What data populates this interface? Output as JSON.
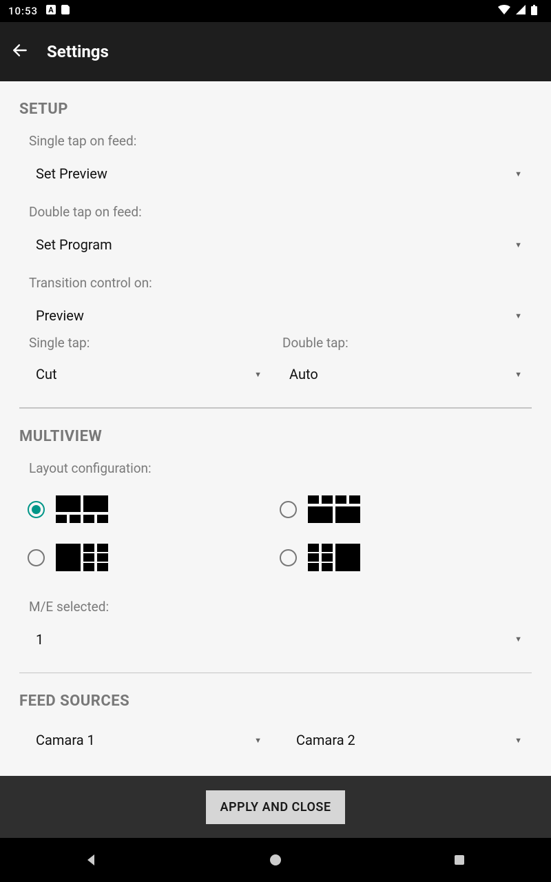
{
  "status": {
    "time": "10:53"
  },
  "header": {
    "title": "Settings"
  },
  "setup": {
    "heading": "SETUP",
    "single_tap_feed_label": "Single tap on feed:",
    "single_tap_feed_value": "Set Preview",
    "double_tap_feed_label": "Double tap on feed:",
    "double_tap_feed_value": "Set Program",
    "transition_label": "Transition control on:",
    "transition_value": "Preview",
    "single_tap_label": "Single tap:",
    "single_tap_value": "Cut",
    "double_tap_label": "Double tap:",
    "double_tap_value": "Auto"
  },
  "multiview": {
    "heading": "MULTIVIEW",
    "layout_label": "Layout configuration:",
    "selected_layout": 0,
    "me_label": "M/E selected:",
    "me_value": "1"
  },
  "feed_sources": {
    "heading": "FEED SOURCES",
    "slot1": "Camara 1",
    "slot2": "Camara 2"
  },
  "actions": {
    "apply": "APPLY AND CLOSE"
  }
}
